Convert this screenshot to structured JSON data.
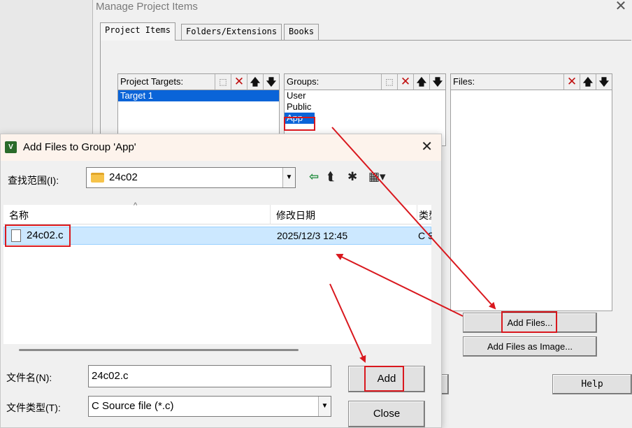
{
  "manage_window": {
    "title": "Manage Project Items",
    "close_glyph": "✕",
    "tabs": [
      "Project Items",
      "Folders/Extensions",
      "Books"
    ],
    "targets": {
      "label": "Project Targets:",
      "items": [
        "Target 1"
      ]
    },
    "groups": {
      "label": "Groups:",
      "items": [
        "User",
        "Public",
        "App"
      ],
      "selected": "App"
    },
    "files": {
      "label": "Files:"
    },
    "toolbar_glyphs": {
      "new": "⬚",
      "delete": "✕",
      "up": "🡅",
      "down": "🡇"
    },
    "buttons": {
      "add_files": "Add Files...",
      "add_as_image": "Add Files as Image...",
      "help": "Help"
    }
  },
  "add_dialog": {
    "title": "Add Files to Group 'App'",
    "app_icon": "V",
    "close_glyph": "✕",
    "look_in": {
      "label": "查找范围(I):",
      "value": "24c02"
    },
    "nav_icons": {
      "back": "⇦",
      "up_folder": "⮬",
      "new_folder": "✱",
      "view_menu": "▦▾"
    },
    "columns": [
      "名称",
      "修改日期",
      "类型"
    ],
    "sort_glyph": "^",
    "rows": [
      {
        "name": "24c02.c",
        "modified": "2025/12/3 12:45",
        "type": "C Source file"
      }
    ],
    "file_name": {
      "label": "文件名(N):",
      "value": "24c02.c"
    },
    "file_type": {
      "label": "文件类型(T):",
      "value": "C Source file (*.c)"
    },
    "dropdown_glyph": "▼",
    "buttons": {
      "add": "Add",
      "close": "Close"
    }
  },
  "colors": {
    "annotation": "#d9181e",
    "selection": "#0a64d8",
    "row_highlight": "#cce8ff"
  }
}
